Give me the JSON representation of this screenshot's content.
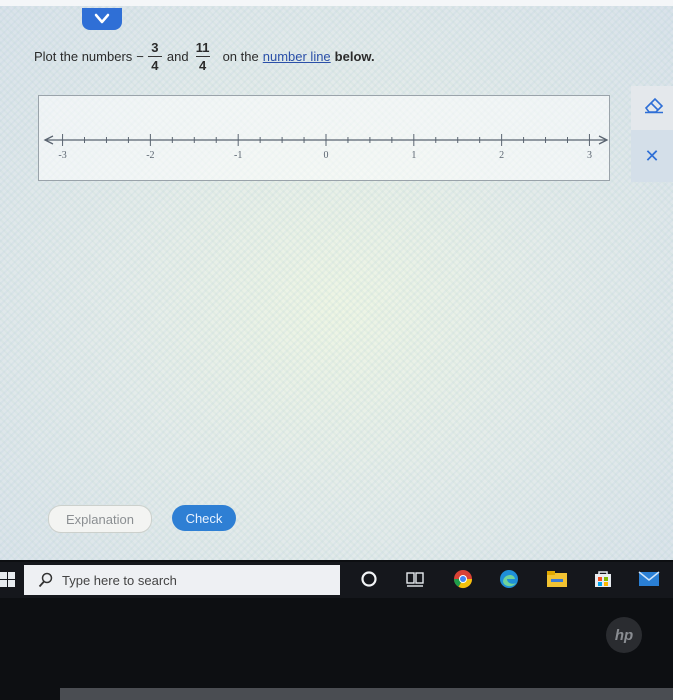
{
  "question": {
    "prefix": "Plot the numbers",
    "frac1": {
      "sign": "−",
      "numerator": "3",
      "denominator": "4"
    },
    "conjunction": "and",
    "frac2": {
      "numerator": "11",
      "denominator": "4"
    },
    "middle": "on the",
    "link_text": "number line",
    "suffix": "below."
  },
  "number_line": {
    "min": -3.2,
    "max": 3.2,
    "labels": [
      "-3",
      "-2",
      "-1",
      "0",
      "1",
      "2",
      "3"
    ],
    "label_values": [
      -3,
      -2,
      -1,
      0,
      1,
      2,
      3
    ],
    "minor_step": 0.25
  },
  "buttons": {
    "explanation_label": "Explanation",
    "check_label": "Check"
  },
  "taskbar": {
    "search_placeholder": "Type here to search",
    "icons": [
      "cortana-circle-icon",
      "task-view-icon",
      "chrome-icon",
      "edge-icon",
      "file-explorer-icon",
      "microsoft-store-icon",
      "mail-icon"
    ]
  },
  "colors": {
    "accent": "#2f6fd6",
    "check_button": "#2e7fd4",
    "link": "#2a4fa8"
  },
  "brand": "hp"
}
